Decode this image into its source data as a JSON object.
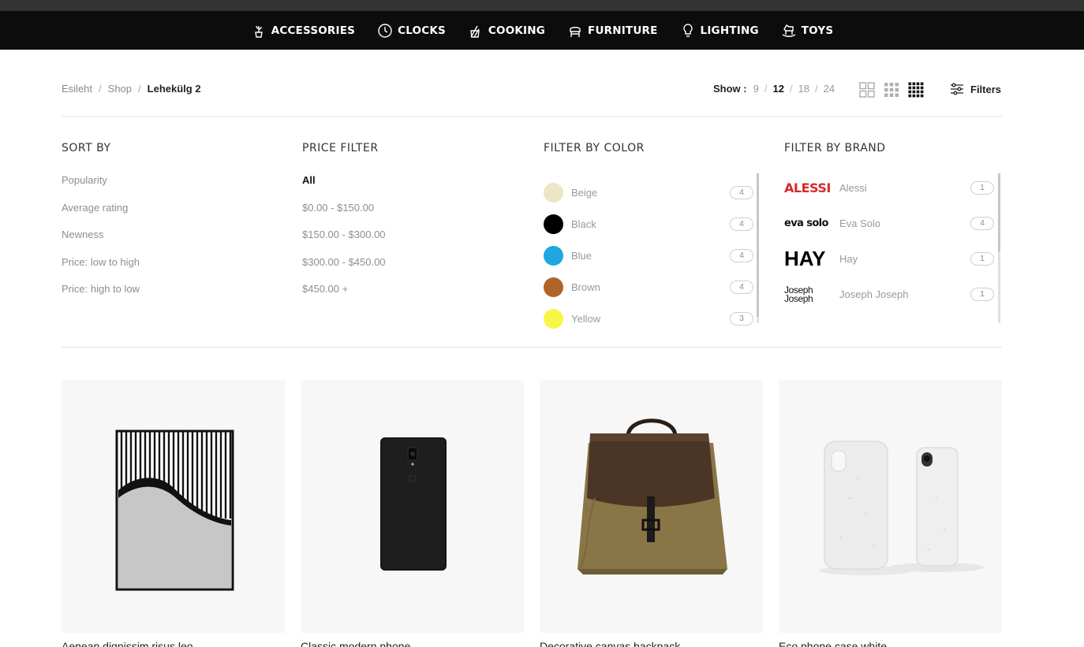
{
  "nav": {
    "categories": [
      {
        "label": "ACCESSORIES",
        "icon": "cactus-pot-icon"
      },
      {
        "label": "CLOCKS",
        "icon": "clock-icon"
      },
      {
        "label": "COOKING",
        "icon": "kitchen-utensils-icon"
      },
      {
        "label": "FURNITURE",
        "icon": "armchair-icon"
      },
      {
        "label": "LIGHTING",
        "icon": "lightbulb-icon"
      },
      {
        "label": "TOYS",
        "icon": "rocking-horse-icon"
      }
    ]
  },
  "breadcrumb": {
    "home": "Esileht",
    "shop": "Shop",
    "current": "Lehekülg 2",
    "separator": "/"
  },
  "show": {
    "label": "Show :",
    "options": [
      "9",
      "12",
      "18",
      "24"
    ],
    "active": "12",
    "separator": "/"
  },
  "view_toggle": {
    "options": [
      "grid-2-icon",
      "grid-3-icon",
      "grid-4-icon"
    ],
    "active": "grid-4-icon"
  },
  "filters_button": {
    "label": "Filters",
    "icon": "sliders-icon"
  },
  "sort_by": {
    "title": "SORT BY",
    "options": [
      "Popularity",
      "Average rating",
      "Newness",
      "Price: low to high",
      "Price: high to low"
    ]
  },
  "price_filter": {
    "title": "PRICE FILTER",
    "options": [
      "All",
      "$0.00 - $150.00",
      "$150.00 - $300.00",
      "$300.00 - $450.00",
      "$450.00 +"
    ],
    "selected": "All"
  },
  "color_filter": {
    "title": "FILTER BY COLOR",
    "colors": [
      {
        "name": "Beige",
        "count": "4",
        "hex": "#ede5c6"
      },
      {
        "name": "Black",
        "count": "4",
        "hex": "#000000"
      },
      {
        "name": "Blue",
        "count": "4",
        "hex": "#1fa6e3"
      },
      {
        "name": "Brown",
        "count": "4",
        "hex": "#b06428"
      },
      {
        "name": "Yellow",
        "count": "3",
        "hex": "#f7f546"
      }
    ]
  },
  "brand_filter": {
    "title": "FILTER BY BRAND",
    "brands": [
      {
        "name": "Alessi",
        "count": "1",
        "logo_text": "ALESSI"
      },
      {
        "name": "Eva Solo",
        "count": "4",
        "logo_text": "eva solo"
      },
      {
        "name": "Hay",
        "count": "1",
        "logo_text": "HAY"
      },
      {
        "name": "Joseph Joseph",
        "count": "1",
        "logo_text": "Joseph Joseph"
      }
    ]
  },
  "products": [
    {
      "title": "Aenean dignissim risus leo",
      "image": "wave-art-print"
    },
    {
      "title": "Classic modern phone",
      "image": "black-smartphone"
    },
    {
      "title": "Decorative canvas backpack",
      "image": "canvas-leather-backpack"
    },
    {
      "title": "Eco phone case white",
      "image": "white-phone-cases"
    }
  ],
  "colors": {
    "nav_bg": "#0c0c0c",
    "top_strip": "#333333",
    "accent_text": "#222222",
    "muted_text": "#8e8e8e",
    "card_bg": "#f7f7f7",
    "alessi_red": "#d62a2a"
  }
}
